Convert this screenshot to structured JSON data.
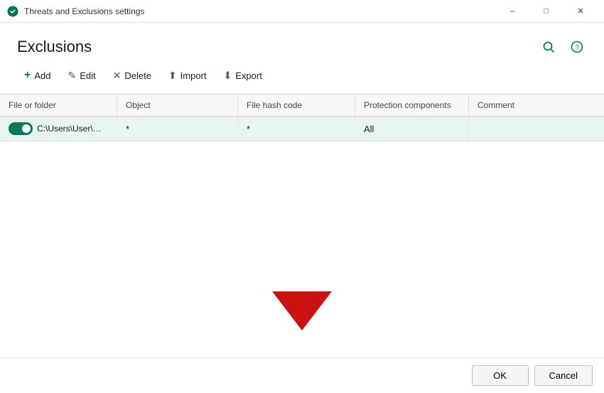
{
  "titlebar": {
    "title": "Threats and Exclusions settings",
    "minimize_label": "–",
    "maximize_label": "□",
    "close_label": "✕"
  },
  "header": {
    "title": "Exclusions",
    "search_icon": "🔍",
    "help_icon": "?"
  },
  "toolbar": {
    "add_label": "Add",
    "edit_label": "Edit",
    "delete_label": "Delete",
    "import_label": "Import",
    "export_label": "Export"
  },
  "table": {
    "columns": [
      "File or folder",
      "Object",
      "File hash code",
      "Protection components",
      "Comment"
    ],
    "rows": [
      {
        "toggle_on": true,
        "file_or_folder": "C:\\Users\\User\\OneDriv",
        "object": "*",
        "file_hash_code": "*",
        "protection_components": "All",
        "comment": ""
      }
    ]
  },
  "footer": {
    "ok_label": "OK",
    "cancel_label": "Cancel"
  }
}
